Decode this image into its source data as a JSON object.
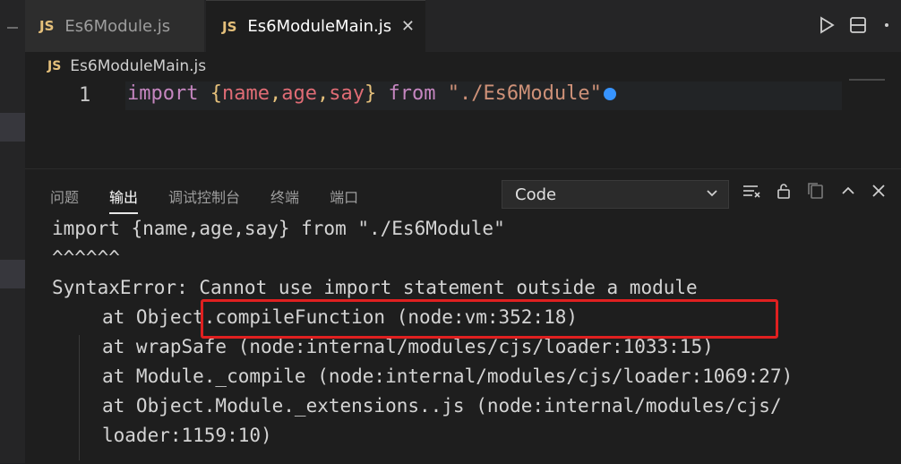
{
  "tabs": [
    {
      "label": "Es6Module.js",
      "icon": "JS"
    },
    {
      "label": "Es6ModuleMain.js",
      "icon": "JS",
      "close": "✕"
    }
  ],
  "toolbar": {
    "run_icon": "play-icon",
    "split_icon": "split-editor-icon",
    "more_icon": "more-icon"
  },
  "breadcrumb": {
    "icon": "JS",
    "file": "Es6ModuleMain.js"
  },
  "editor": {
    "line_number": "1",
    "tokens": {
      "kw_import": "import",
      "lbrace": "{",
      "name": "name",
      "comma1": ",",
      "age": "age",
      "comma2": ",",
      "say": "say",
      "rbrace": "}",
      "kw_from": "from",
      "str": "\"./Es6Module\""
    }
  },
  "panel": {
    "tabs": [
      "问题",
      "输出",
      "调试控制台",
      "终端",
      "端口"
    ],
    "select_value": "Code",
    "output_lines": [
      "import {name,age,say} from \"./Es6Module\"",
      "^^^^^^",
      "",
      "SyntaxError: Cannot use import statement outside a module",
      "at Object.compileFunction (node:vm:352:18)",
      "at wrapSafe (node:internal/modules/cjs/loader:1033:15)",
      "at Module._compile (node:internal/modules/cjs/loader:1069:27)",
      "at Object.Module._extensions..js (node:internal/modules/cjs/",
      "loader:1159:10)"
    ]
  }
}
